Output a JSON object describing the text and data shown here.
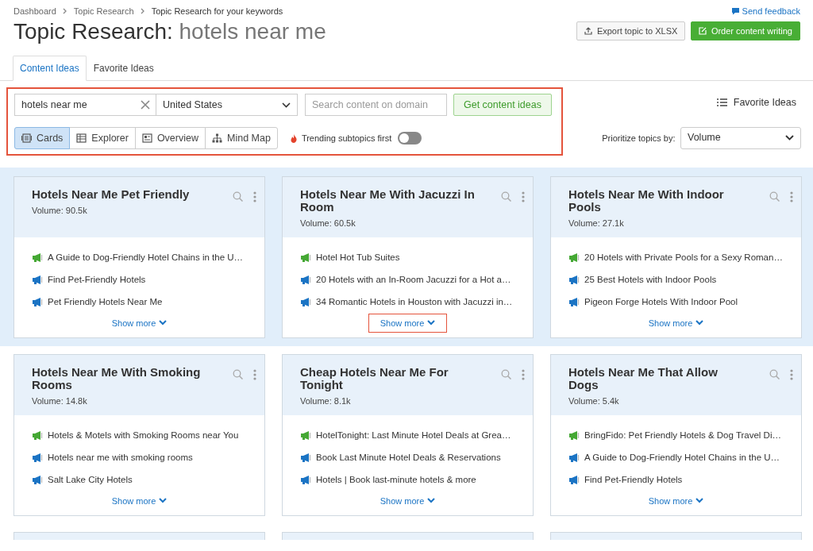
{
  "breadcrumbs": [
    "Dashboard",
    "Topic Research",
    "Topic Research for your keywords"
  ],
  "feedback": "Send feedback",
  "title": {
    "label": "Topic Research:",
    "keyword": "hotels near me"
  },
  "actions": [
    {
      "kind": "export",
      "label": "Export topic to XLSX"
    },
    {
      "kind": "order",
      "label": "Order content writing"
    }
  ],
  "tabs": [
    {
      "label": "Content Ideas",
      "selected": true
    },
    {
      "label": "Favorite Ideas",
      "selected": false
    }
  ],
  "filters": {
    "highlighted": true,
    "keyword": "hotels near me",
    "country": "United States",
    "domain": {
      "placeholder": "Search content on domain"
    },
    "submit": "Get content ideas",
    "views": [
      {
        "kind": "cards",
        "label": "Cards",
        "selected": true
      },
      {
        "kind": "explorer",
        "label": "Explorer",
        "selected": false
      },
      {
        "kind": "overview",
        "label": "Overview",
        "selected": false
      },
      {
        "kind": "mindmap",
        "label": "Mind Map",
        "selected": false
      }
    ],
    "trending": {
      "label": "Trending subtopics first",
      "on": false
    }
  },
  "favorites_link": "Favorite Ideas",
  "sort": {
    "label": "Prioritize topics by:",
    "value": "Volume"
  },
  "card_rows": [
    {
      "highlighted": true,
      "cards": [
        {
          "title": "Hotels Near Me Pet Friendly",
          "volume": "Volume:  90.5k",
          "show_more": "Show more",
          "show_more_highlighted": false,
          "items": [
            {
              "text": "A Guide to Dog-Friendly Hotel Chains in the U…",
              "color": "#45a834"
            },
            {
              "text": "Find Pet-Friendly Hotels",
              "color": "#1b74c4"
            },
            {
              "text": "Pet Friendly Hotels Near Me",
              "color": "#1b74c4"
            }
          ]
        },
        {
          "title": "Hotels Near Me With Jacuzzi In Room",
          "volume": "Volume:  60.5k",
          "show_more": "Show more",
          "show_more_highlighted": true,
          "items": [
            {
              "text": "Hotel Hot Tub Suites",
              "color": "#45a834"
            },
            {
              "text": "20 Hotels with an In-Room Jacuzzi for a Hot a…",
              "color": "#1b74c4"
            },
            {
              "text": "34 Romantic Hotels in Houston with Jacuzzi in…",
              "color": "#1b74c4"
            }
          ]
        },
        {
          "title": "Hotels Near Me With Indoor Pools",
          "volume": "Volume:  27.1k",
          "show_more": "Show more",
          "show_more_highlighted": false,
          "items": [
            {
              "text": "20 Hotels with Private Pools for a Sexy Roman…",
              "color": "#45a834"
            },
            {
              "text": "25 Best Hotels with Indoor Pools",
              "color": "#1b74c4"
            },
            {
              "text": "Pigeon Forge Hotels With Indoor Pool",
              "color": "#1b74c4"
            }
          ]
        }
      ]
    },
    {
      "highlighted": false,
      "cards": [
        {
          "title": "Hotels Near Me With Smoking Rooms",
          "volume": "Volume:  14.8k",
          "show_more": "Show more",
          "show_more_highlighted": false,
          "items": [
            {
              "text": "Hotels & Motels with Smoking Rooms near You",
              "color": "#45a834"
            },
            {
              "text": "Hotels near me with smoking rooms",
              "color": "#1b74c4"
            },
            {
              "text": "Salt Lake City Hotels",
              "color": "#1b74c4"
            }
          ]
        },
        {
          "title": "Cheap Hotels Near Me For Tonight",
          "volume": "Volume:  8.1k",
          "show_more": "Show more",
          "show_more_highlighted": false,
          "items": [
            {
              "text": "HotelTonight: Last Minute Hotel Deals at Grea…",
              "color": "#45a834"
            },
            {
              "text": "Book Last Minute Hotel Deals & Reservations",
              "color": "#1b74c4"
            },
            {
              "text": "Hotels | Book last-minute hotels & more",
              "color": "#1b74c4"
            }
          ]
        },
        {
          "title": "Hotels Near Me That Allow Dogs",
          "volume": "Volume:  5.4k",
          "show_more": "Show more",
          "show_more_highlighted": false,
          "items": [
            {
              "text": "BringFido: Pet Friendly Hotels & Dog Travel Di…",
              "color": "#45a834"
            },
            {
              "text": "A Guide to Dog-Friendly Hotel Chains in the U…",
              "color": "#1b74c4"
            },
            {
              "text": "Find Pet-Friendly Hotels",
              "color": "#1b74c4"
            }
          ]
        }
      ]
    }
  ]
}
